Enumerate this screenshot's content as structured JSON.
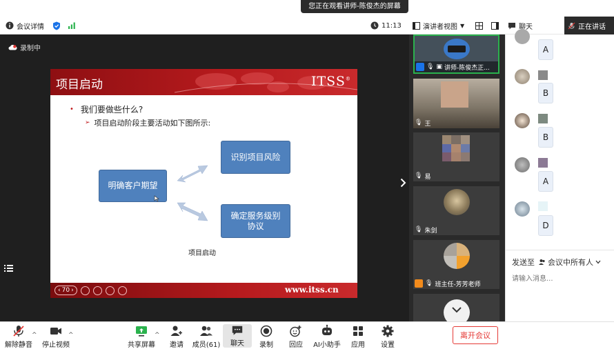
{
  "banner": {
    "text": "您正在观看讲师-陈俊杰的屏幕"
  },
  "topbar": {
    "meeting_info": "会议详情",
    "time": "11:13",
    "view_mode": "演讲者视图",
    "chat": "聊天",
    "speaking": "正在讲话"
  },
  "recording": {
    "label": "录制中"
  },
  "slide": {
    "title": "项目启动",
    "logo": "ITSS",
    "logo_tm": "®",
    "bullet1": "我们要做些什么?",
    "bullet2": "项目启动阶段主要活动如下图所示:",
    "box_left": "明确客户期望",
    "box_top": "识别项目风险",
    "box_bottom_l1": "确定服务级别",
    "box_bottom_l2": "协议",
    "caption": "项目启动",
    "page_num": "70",
    "footer_url": "www.itss.cn"
  },
  "videos": [
    {
      "name": "讲师-陈俊杰正..."
    },
    {
      "name": "王"
    },
    {
      "name": "易"
    },
    {
      "name": "朱剑"
    },
    {
      "name": "班主任-芳芳老师"
    }
  ],
  "chat": {
    "messages": [
      {
        "answer": "A"
      },
      {
        "answer": "B"
      },
      {
        "answer": "B"
      },
      {
        "answer": "A"
      },
      {
        "answer": "D"
      }
    ],
    "send_to_label": "发送至",
    "send_to_value": "会议中所有人",
    "input_placeholder": "请输入消息..."
  },
  "toolbar": {
    "unmute": "解除静音",
    "stop_video": "停止视频",
    "share_screen": "共享屏幕",
    "invite": "邀请",
    "members": "成员(61)",
    "chat": "聊天",
    "record": "录制",
    "replay": "回应",
    "ai_assistant": "AI小助手",
    "apps": "应用",
    "settings": "设置",
    "leave": "离开会议"
  },
  "colors": {
    "accent_blue": "#1a73e8",
    "slide_red": "#b51a1d",
    "box_blue": "#4f81bd",
    "leave_red": "#e53935",
    "tile_green": "#2ab24d"
  }
}
